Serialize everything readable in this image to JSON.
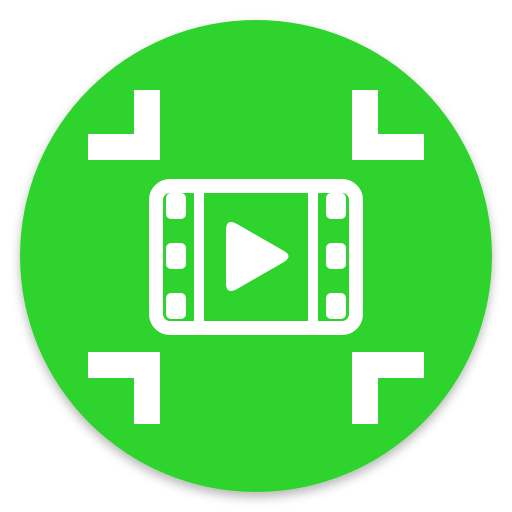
{
  "icon": {
    "name": "video-compress-app-icon",
    "background_color": "#2fd32f",
    "foreground_color": "#ffffff",
    "glyphs": [
      "film-strip-icon",
      "play-icon",
      "compress-corner-icons"
    ]
  }
}
